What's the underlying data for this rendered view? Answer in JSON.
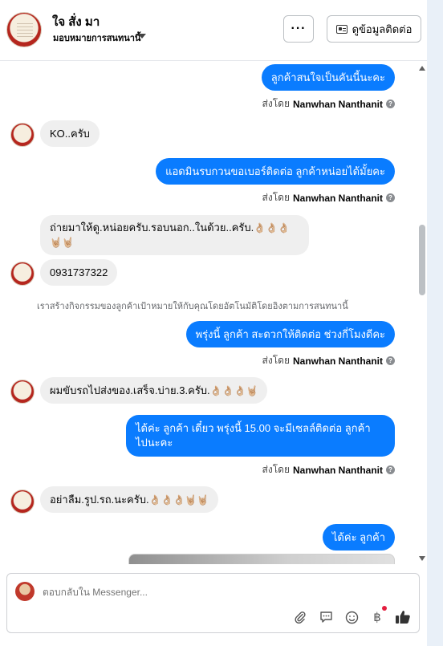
{
  "header": {
    "contact_name": "ใจ สั่ง มา",
    "assign_label": "มอบหมายการสนทนานี้",
    "more_label": "···",
    "info_button_label": "ดูข้อมูลติดต่อ"
  },
  "messages": {
    "m1": "ลูกค้าสนใจเป็นคันนี้นะคะ",
    "m2": "KO..ครับ",
    "m3": "แอดมินรบกวนขอเบอร์ติดต่อ ลูกค้าหน่อยได้มั้ยคะ",
    "m4_line1": "ถ่ายมาให้ดู.หน่อยครับ.รอบนอก..ในด้วย..ครับ.",
    "m4_emojis1": "👌🏼👌🏼👌🏼",
    "m4_emojis2": "🤘🏼🤘🏼",
    "m5": "0931737322",
    "m6": "พรุ่งนี้ ลูกค้า สะดวกให้ติดต่อ ช่วงกี่โมงดีคะ",
    "m7": "ผมขับรถไปส่งของ.เสร็จ.บ่าย.3.ครับ.",
    "m7_emojis": "👌🏼👌🏼👌🏼🤘🏼",
    "m8_line1": "ได้ค่ะ ลูกค้า เดี๋ยว พรุ่งนี้ 15.00 จะมีเซลล์ติดต่อ ลูกค้า",
    "m8_line2": "ไปนะคะ",
    "m9": "อย่าลืม.รูป.รถ.นะครับ.",
    "m9_emojis": "👌🏼👌🏼👌🏼🤘🏼🤘🏼",
    "m10": "ได้ค่ะ ลูกค้า"
  },
  "sent_by": {
    "prefix": "ส่งโดย",
    "name": "Nanwhan Nanthanit"
  },
  "notice": "เราสร้างกิจกรรมของลูกค้าเป้าหมายให้กับคุณโดยอัตโนมัติโดยอิงตามการสนทนานี้",
  "composer": {
    "placeholder": "ตอบกลับใน Messenger..."
  },
  "icons": {
    "attach": "paperclip-icon",
    "saved_reply": "chat-bubble-icon",
    "emoji": "smiley-icon",
    "payment": "baht-icon",
    "like": "thumbs-up-icon"
  },
  "colors": {
    "outgoing_bubble": "#0a7cff",
    "incoming_bubble": "#efefef",
    "notification_dot": "#e41e3f"
  }
}
